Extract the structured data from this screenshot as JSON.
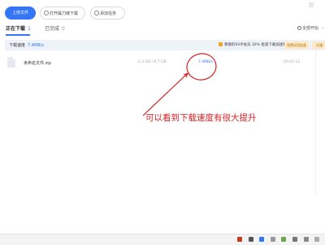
{
  "toolbar": {
    "upload_label": "上传文件",
    "btn_a_label": "打开磁力链下载",
    "btn_b_label": "添加任务"
  },
  "tabs": {
    "downloading_label": "正在下载",
    "downloading_count": "1",
    "done_label": "已完成",
    "done_count": "0"
  },
  "controls": {
    "all_start_label": "全部开始",
    "more_label": "⋯"
  },
  "status_bar": {
    "speed_label": "下载速度",
    "speed_value": "7.4MB/s",
    "vip_notice": "尊敬的SVIP会员 30% 极速下载加速特权",
    "pill_1": "免费试用加速",
    "pill_2": "开通"
  },
  "files": [
    {
      "name": "未命名文件.zip",
      "size": "2.4 GB / 8.7 GB",
      "speed": "7.4MB/s",
      "remaining": "00:01:12"
    }
  ],
  "annotation": {
    "text": "可以看到下载速度有很大提升",
    "color": "#d62020"
  },
  "colors": {
    "accent": "#3476f6",
    "annotation": "#d62020"
  }
}
